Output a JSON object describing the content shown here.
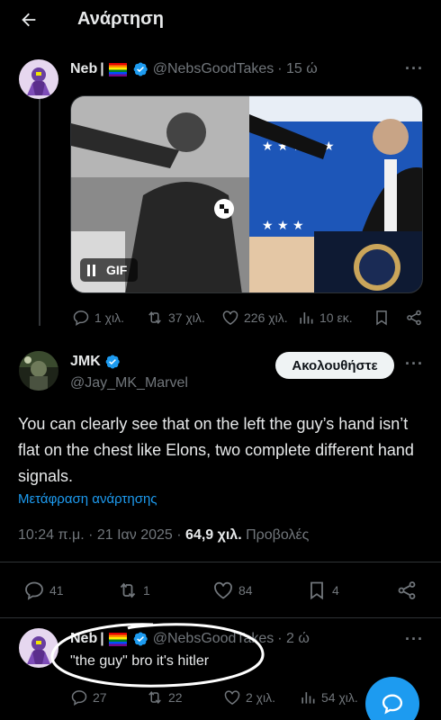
{
  "header": {
    "title": "Ανάρτηση"
  },
  "icons": {
    "back": "arrow-left-icon",
    "more": "more-horizontal-icon",
    "verified": "verified-badge-icon",
    "flag": "rainbow-flag-icon"
  },
  "colors": {
    "accent": "#1d9bf0",
    "muted": "#71767b",
    "background": "#000000",
    "text": "#e7e9ea"
  },
  "post1": {
    "name": "Neb",
    "separator": "|",
    "handle": "@NebsGoodTakes",
    "time": "· 15 ώ",
    "more": "···",
    "gif_label": "GIF",
    "stats": {
      "replies": "1 χιλ.",
      "reposts": "37 χιλ.",
      "likes": "226 χιλ.",
      "views": "10 εκ."
    }
  },
  "post2": {
    "name": "JMK",
    "handle": "@Jay_MK_Marvel",
    "follow_label": "Ακολουθήστε",
    "more": "···",
    "text": "You can clearly see that on the left the guy’s hand isn’t flat on the chest like Elons, two complete different hand signals.",
    "translate": "Μετάφραση ανάρτησης",
    "time": "10:24 π.μ. · 21 Ιαν 2025 · ",
    "views_count": "64,9 χιλ.",
    "views_label": " Προβολές",
    "stats": {
      "replies": "41",
      "reposts": "1",
      "likes": "84",
      "bookmarks": "4"
    }
  },
  "post3": {
    "name": "Neb",
    "separator": "|",
    "handle": "@NebsGoodTakes",
    "time": "· 2 ώ",
    "more": "···",
    "text": "\"the guy\" bro it's hitler",
    "stats": {
      "replies": "27",
      "reposts": "22",
      "likes": "2 χιλ.",
      "views": "54 χιλ."
    }
  }
}
